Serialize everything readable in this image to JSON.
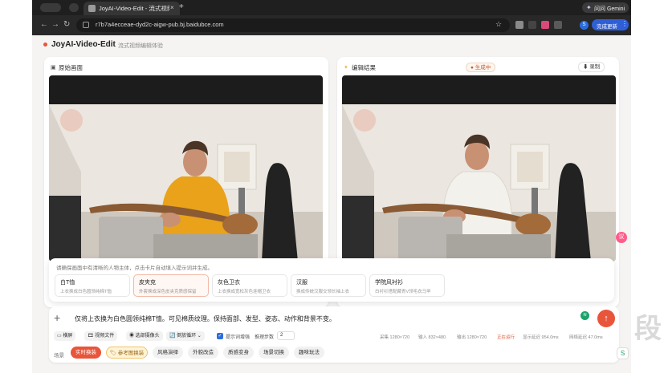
{
  "browser": {
    "tab_title": "JoyAI-Video-Edit - 流式视频编...",
    "tab_close": "×",
    "new_tab": "+",
    "gemini_label": "问问 Gemini",
    "url": "r7b7a4ecceae-dyd2c-aigw-pub.bj.baidubce.com",
    "update_label": "完成更新",
    "update_more": "⋮",
    "profile_initial": "S",
    "back": "←",
    "forward": "→",
    "reload": "↻",
    "star": "☆"
  },
  "app": {
    "title": "JoyAI-Video-Edit",
    "subtitle": "流式视频编辑体验",
    "accent_color": "#e8553a"
  },
  "left_panel": {
    "icon": "▣",
    "title": "原始画面"
  },
  "right_panel": {
    "icon": "✦",
    "title": "编辑结果",
    "status": "● 生成中",
    "record_label": "⬇ 录制"
  },
  "suggestions": {
    "hint": "请确保画面中有清晰的人物主体，点击卡片自动填入提示词并生成。",
    "items": [
      {
        "title": "白T恤",
        "desc": "上衣换成白色圆领纯棉T恤"
      },
      {
        "title": "皮夹克",
        "desc": "外套换成深色皮夹克质感保留"
      },
      {
        "title": "灰色卫衣",
        "desc": "上衣换成宽松灰色连帽卫衣"
      },
      {
        "title": "汉服",
        "desc": "换成传统汉服交领长袖上衣"
      },
      {
        "title": "学院风衬衫",
        "desc": "白衬衫搭配藏青V领毛衣马甲"
      }
    ]
  },
  "composer": {
    "plus": "+",
    "prompt": "仅将上衣换为白色圆领纯棉T恤。可见棉质纹理。保持面部、发型、姿态、动作和背景不变。",
    "send": "↑",
    "badge": "≋",
    "controls": {
      "horizontal": "▭ 横屏",
      "video_file": "🎞 视频文件",
      "webcam": "◉ 选部摄像头",
      "loop": "🔄 倒放循环 ⌄",
      "check": "✓",
      "loop_label": "提示词增强",
      "steps_label": "推理步数",
      "steps_value": "2"
    },
    "stats": {
      "capture": "采集 1280×720",
      "input": "输入 832×480",
      "output": "输出 1280×720",
      "running": "正在运行",
      "display_latency": "显示延迟 954.0ms",
      "network_latency": "网络延迟 47.0ms"
    },
    "scene_label": "场景",
    "scenes": [
      {
        "label": "实时换装",
        "style": "primary"
      },
      {
        "label": "🏷 参考图换装",
        "style": "secondary"
      },
      {
        "label": "风格演绎",
        "style": "normal"
      },
      {
        "label": "外貌改造",
        "style": "normal"
      },
      {
        "label": "质感变身",
        "style": "normal"
      },
      {
        "label": "场景切换",
        "style": "normal"
      },
      {
        "label": "趣味玩法",
        "style": "normal"
      }
    ]
  },
  "overlays": {
    "float_badge": "议",
    "corner_badge": "S",
    "side_glyph": "段"
  },
  "video_colors": {
    "original_sweater": "#e9a21a",
    "edited_tshirt": "#f3f1ec"
  }
}
